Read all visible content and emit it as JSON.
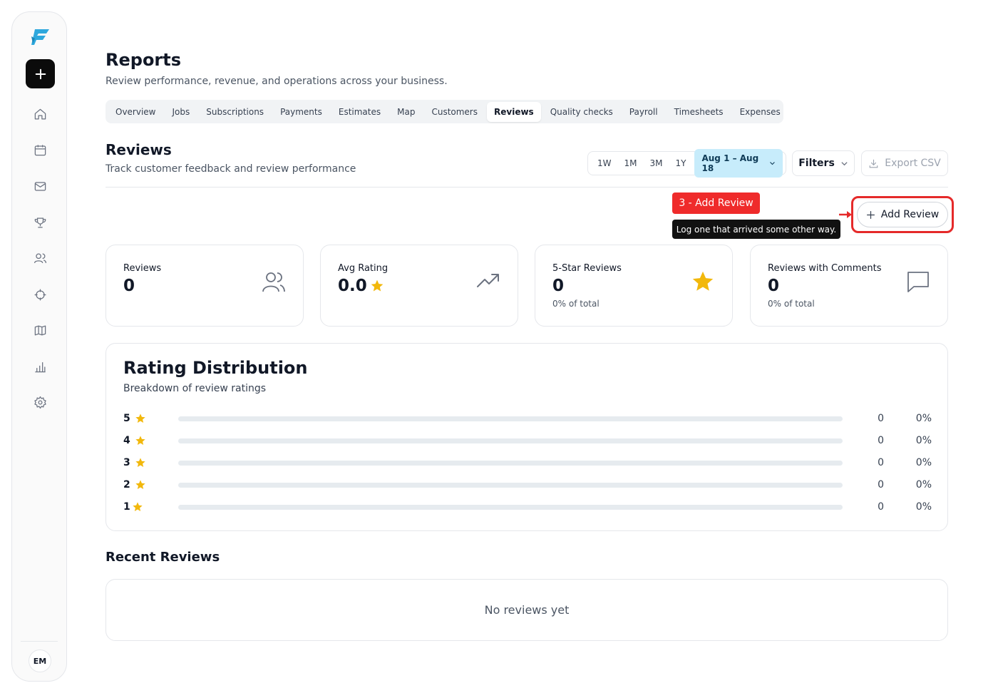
{
  "sidebar": {
    "avatar_initials": "EM",
    "nav": [
      "home-icon",
      "calendar-icon",
      "mail-icon",
      "trophy-icon",
      "users-icon",
      "crosshair-icon",
      "map-icon",
      "chart-icon",
      "settings-icon"
    ]
  },
  "header": {
    "title": "Reports",
    "subtitle": "Review performance, revenue, and operations across your business."
  },
  "tabs": [
    {
      "label": "Overview"
    },
    {
      "label": "Jobs"
    },
    {
      "label": "Subscriptions"
    },
    {
      "label": "Payments"
    },
    {
      "label": "Estimates"
    },
    {
      "label": "Map"
    },
    {
      "label": "Customers"
    },
    {
      "label": "Reviews",
      "active": true
    },
    {
      "label": "Quality checks"
    },
    {
      "label": "Payroll"
    },
    {
      "label": "Timesheets"
    },
    {
      "label": "Expenses"
    }
  ],
  "section": {
    "title": "Reviews",
    "subtitle": "Track customer feedback and review performance"
  },
  "range": {
    "options": [
      "1W",
      "1M",
      "3M",
      "1Y"
    ],
    "date_label": "Aug 1 – Aug 18"
  },
  "actions": {
    "filters_label": "Filters",
    "export_label": "Export CSV",
    "add_review_label": "Add Review"
  },
  "annotation": {
    "badge": "3 - Add Review",
    "tooltip": "Log one that arrived some other way."
  },
  "stats": [
    {
      "label": "Reviews",
      "value": "0",
      "note": ""
    },
    {
      "label": "Avg Rating",
      "value": "0.0",
      "note": ""
    },
    {
      "label": "5-Star Reviews",
      "value": "0",
      "note": "0% of total"
    },
    {
      "label": "Reviews with Comments",
      "value": "0",
      "note": "0% of total"
    }
  ],
  "distribution": {
    "title": "Rating Distribution",
    "subtitle": "Breakdown of review ratings",
    "rows": [
      {
        "stars": "5",
        "count": "0",
        "percent": "0%",
        "fill": 0
      },
      {
        "stars": "4",
        "count": "0",
        "percent": "0%",
        "fill": 0
      },
      {
        "stars": "3",
        "count": "0",
        "percent": "0%",
        "fill": 0
      },
      {
        "stars": "2",
        "count": "0",
        "percent": "0%",
        "fill": 0
      },
      {
        "stars": "1",
        "count": "0",
        "percent": "0%",
        "fill": 0
      }
    ]
  },
  "recent": {
    "title": "Recent Reviews",
    "empty": "No reviews yet"
  },
  "colors": {
    "accent": "#c7ecfb",
    "star": "#f2b80c",
    "annotation": "#ef2b2b"
  }
}
